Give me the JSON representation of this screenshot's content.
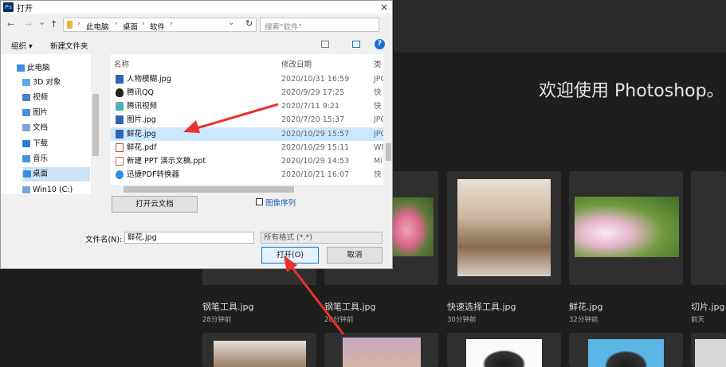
{
  "photoshop": {
    "welcome": "欢迎使用 Photoshop。",
    "recent_files": [
      {
        "name": "钢笔工具.jpg",
        "time": "28分钟前"
      },
      {
        "name": "钢笔工具.jpg",
        "time": "28分钟前"
      },
      {
        "name": "快速选择工具.jpg",
        "time": "30分钟前"
      },
      {
        "name": "鲜花.jpg",
        "time": "32分钟前"
      },
      {
        "name": "切片.jpg",
        "time": "前天"
      }
    ]
  },
  "dialog": {
    "title": "打开",
    "app_badge": "Ps",
    "close": "×",
    "nav": {
      "back": "←",
      "forward": "→",
      "recent": "⌄",
      "up": "↑",
      "refresh": "↻",
      "path_dropdown": "⌄"
    },
    "breadcrumb": [
      "此电脑",
      "桌面",
      "软件"
    ],
    "breadcrumb_sep": "›",
    "search_placeholder": "搜索\"软件\"",
    "toolbar": {
      "organize": "组织 ▾",
      "new_folder": "新建文件夹",
      "help": "?"
    },
    "nav_items": [
      {
        "label": "此电脑",
        "icon": "computer-icon",
        "color": "#3c8de0"
      },
      {
        "label": "3D 对象",
        "icon": "cube-icon",
        "color": "#5aa9e6"
      },
      {
        "label": "视频",
        "icon": "video-icon",
        "color": "#4a7fc1"
      },
      {
        "label": "图片",
        "icon": "picture-icon",
        "color": "#4a90d9"
      },
      {
        "label": "文档",
        "icon": "document-icon",
        "color": "#7fa7d1"
      },
      {
        "label": "下载",
        "icon": "download-icon",
        "color": "#2f7ad8"
      },
      {
        "label": "音乐",
        "icon": "music-icon",
        "color": "#4a90d9"
      },
      {
        "label": "桌面",
        "icon": "desktop-icon",
        "color": "#3c8de0"
      },
      {
        "label": "Win10 (C:)",
        "icon": "drive-icon",
        "color": "#7aa3d0"
      }
    ],
    "columns": {
      "name": "名称",
      "modified": "修改日期",
      "type": "类"
    },
    "files": [
      {
        "name": "人物模糊.jpg",
        "date": "2020/10/31 16:59",
        "type": "JPG",
        "icon": "jpg-icon"
      },
      {
        "name": "腾讯QQ",
        "date": "2020/9/29 17:25",
        "type": "快",
        "icon": "qq-icon"
      },
      {
        "name": "腾讯视频",
        "date": "2020/7/11 9:21",
        "type": "快",
        "icon": "video-app-icon"
      },
      {
        "name": "图片.jpg",
        "date": "2020/7/20 15:37",
        "type": "JPG",
        "icon": "jpg-icon"
      },
      {
        "name": "鲜花.jpg",
        "date": "2020/10/29 15:57",
        "type": "JPG",
        "icon": "jpg-icon"
      },
      {
        "name": "鲜花.pdf",
        "date": "2020/10/29 15:11",
        "type": "WI",
        "icon": "pdf-icon"
      },
      {
        "name": "新建 PPT 演示文稿.ppt",
        "date": "2020/10/29 14:53",
        "type": "Mi",
        "icon": "ppt-icon"
      },
      {
        "name": "迅捷PDF转换器",
        "date": "2020/10/21 16:07",
        "type": "快",
        "icon": "pdf-converter-icon"
      }
    ],
    "selected_file_index": 4,
    "cloud_button": "打开云文档",
    "image_sequence": "图像序列",
    "filename_label": "文件名(N):",
    "filename_value": "鲜花.jpg",
    "format_value": "所有格式 (*.*)",
    "open_button": "打开(O)",
    "cancel_button": "取消"
  },
  "colors": {
    "accent": "#0078d7",
    "selection": "#cce8ff",
    "arrow": "#e8322d"
  }
}
